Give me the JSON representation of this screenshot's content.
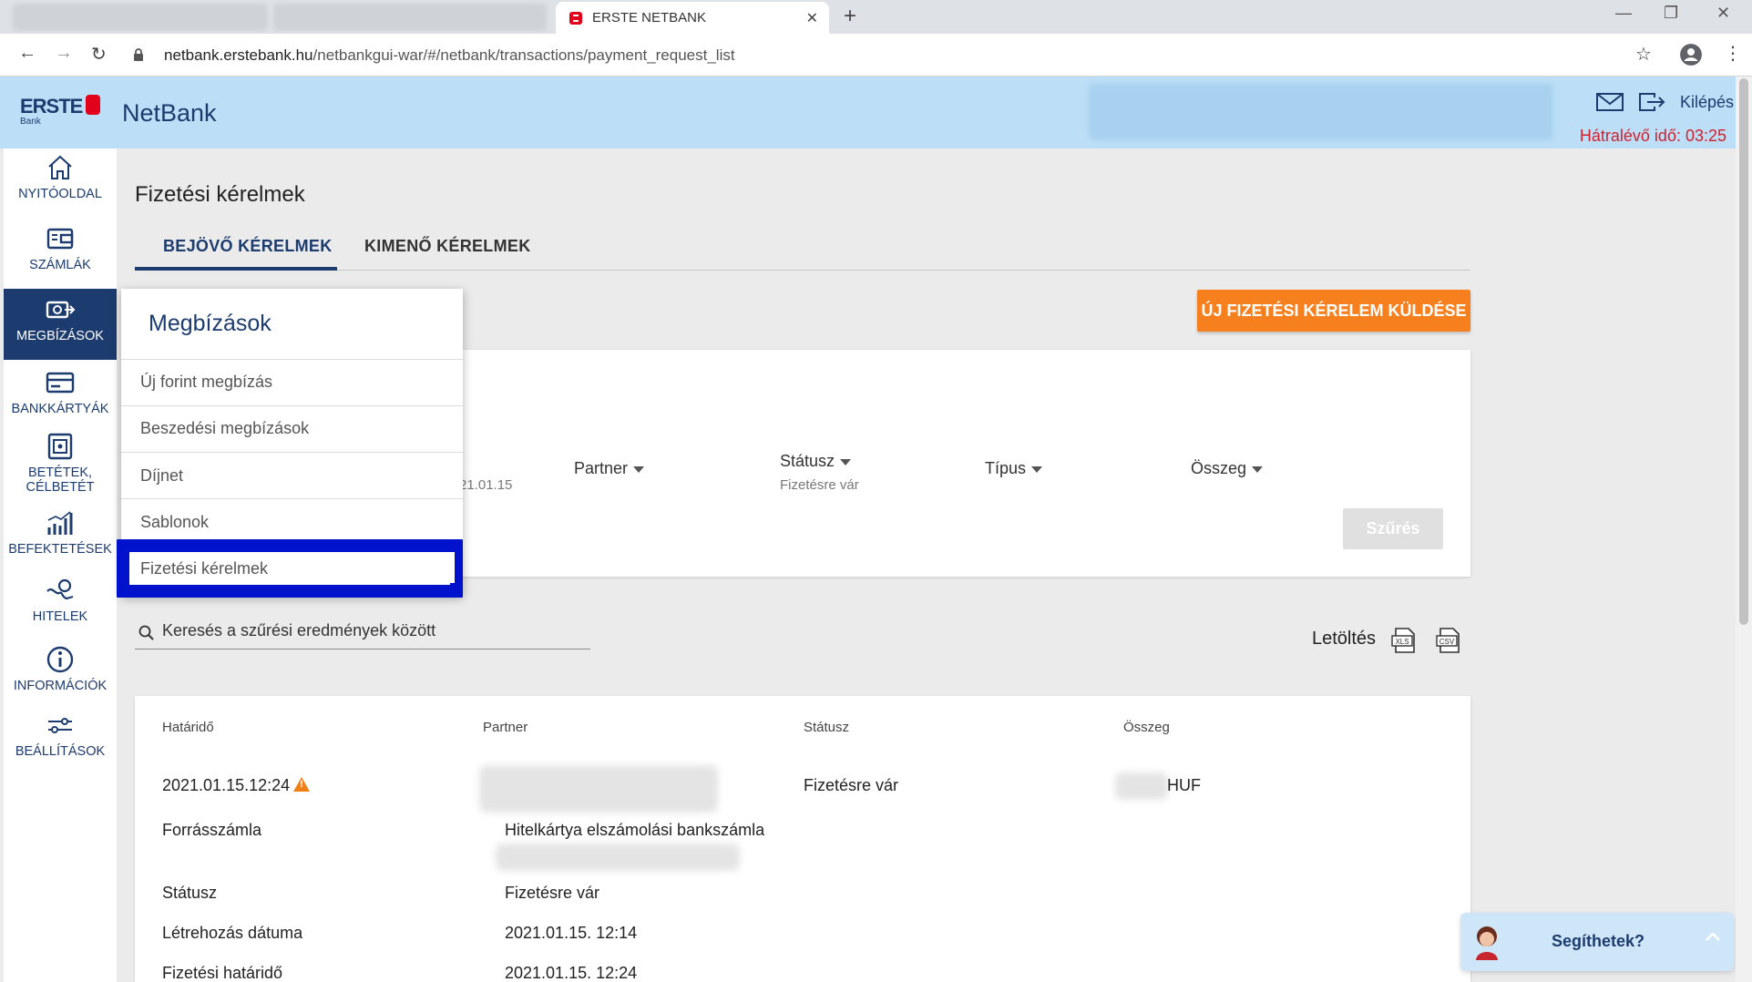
{
  "browser": {
    "tab_title": "ERSTE NETBANK",
    "tab_close": "✕",
    "new_tab": "+",
    "url_host": "netbank.erstebank.hu",
    "url_path": "/netbankgui-war/#/netbank/transactions/payment_request_list",
    "back": "←",
    "forward": "→",
    "reload": "↻",
    "star": "☆",
    "kebab": "⋮",
    "win_min": "—",
    "win_max": "❐",
    "win_close": "✕"
  },
  "header": {
    "logo_text": "ERSTE",
    "logo_sub": "Bank",
    "brand": "NetBank",
    "logout_label": "Kilépés",
    "timer": "Hátralévő idő: 03:25"
  },
  "sidebar": {
    "items": [
      {
        "label": "NYITÓOLDAL",
        "icon": "home-icon"
      },
      {
        "label": "SZÁMLÁK",
        "icon": "wallet-icon"
      },
      {
        "label": "MEGBÍZÁSOK",
        "icon": "transfer-icon"
      },
      {
        "label": "BANKKÁRTYÁK",
        "icon": "card-icon"
      },
      {
        "label": "BETÉTEK,",
        "label2": "CÉLBETÉT",
        "icon": "safe-icon"
      },
      {
        "label": "BEFEKTETÉSEK",
        "icon": "chart-icon"
      },
      {
        "label": "HITELEK",
        "icon": "loan-icon"
      },
      {
        "label": "INFORMÁCIÓK",
        "icon": "info-icon"
      },
      {
        "label": "BEÁLLÍTÁSOK",
        "icon": "settings-icon"
      }
    ]
  },
  "main": {
    "title": "Fizetési kérelmek",
    "tabs": [
      {
        "label": "BEJÖVŐ KÉRELMEK"
      },
      {
        "label": "KIMENŐ KÉRELMEK"
      }
    ],
    "cta": "ÚJ FIZETÉSI KÉRELEM KÜLDÉSE",
    "filters": {
      "date_fragment": "21.01.15",
      "partner": "Partner",
      "status": "Státusz",
      "status_value": "Fizetésre vár",
      "type": "Típus",
      "amount": "Összeg",
      "apply": "Szűrés"
    },
    "search_placeholder": "Keresés a szűrési eredmények között",
    "download_label": "Letöltés",
    "download_xls": "XLS",
    "download_csv": "CSV",
    "table": {
      "headers": [
        "Határidő",
        "Partner",
        "Státusz",
        "Összeg"
      ],
      "row": {
        "deadline": "2021.01.15.12:24",
        "status": "Fizetésre vár",
        "currency": "HUF"
      },
      "details": [
        {
          "label": "Forrásszámla",
          "value": "Hitelkártya elszámolási bankszámla"
        },
        {
          "label": "Státusz",
          "value": "Fizetésre vár"
        },
        {
          "label": "Létrehozás dátuma",
          "value": "2021.01.15. 12:14"
        },
        {
          "label": "Fizetési határidő",
          "value": "2021.01.15. 12:24"
        }
      ]
    }
  },
  "menu": {
    "title": "Megbízások",
    "items": [
      {
        "label": "Új forint megbízás"
      },
      {
        "label": "Beszedési megbízások"
      },
      {
        "label": "Díjnet"
      },
      {
        "label": "Sablonok"
      },
      {
        "label": "Fizetési kérelmek"
      }
    ]
  },
  "chat": {
    "label": "Segíthetek?"
  },
  "colors": {
    "brand_navy": "#1c3b6e",
    "header_bg": "#bcdff7",
    "accent_orange": "#f7801e",
    "timer_red": "#d41f2c",
    "highlight_blue": "#0012cc"
  }
}
